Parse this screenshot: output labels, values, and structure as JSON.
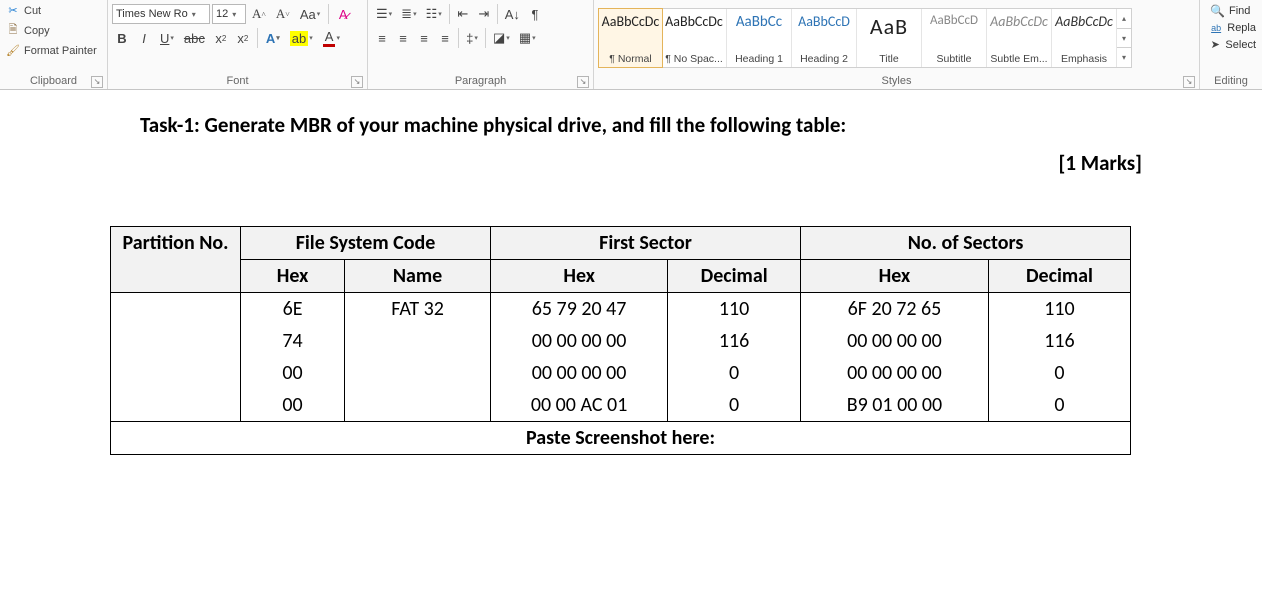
{
  "clipboard": {
    "cut": "Cut",
    "copy": "Copy",
    "format_painter": "Format Painter",
    "label": "Clipboard"
  },
  "font": {
    "name": "Times New Ro",
    "size": "12",
    "label": "Font"
  },
  "paragraph": {
    "label": "Paragraph"
  },
  "styles": {
    "label": "Styles",
    "items": [
      {
        "sample": "AaBbCcDc",
        "name": "¶ Normal"
      },
      {
        "sample": "AaBbCcDc",
        "name": "¶ No Spac..."
      },
      {
        "sample": "AaBbCc",
        "name": "Heading 1"
      },
      {
        "sample": "AaBbCcD",
        "name": "Heading 2"
      },
      {
        "sample": "AaB",
        "name": "Title"
      },
      {
        "sample": "AaBbCcD",
        "name": "Subtitle"
      },
      {
        "sample": "AaBbCcDc",
        "name": "Subtle Em..."
      },
      {
        "sample": "AaBbCcDc",
        "name": "Emphasis"
      }
    ]
  },
  "editing": {
    "label": "Editing",
    "find": "Find",
    "replace": "Repla",
    "select": "Select"
  },
  "doc": {
    "task_title": "Task-1: Generate MBR of your machine physical drive, and fill the following table:",
    "marks": "[1 Marks]",
    "headers": {
      "partition": "Partition No.",
      "fscode": "File System Code",
      "firstsector": "First Sector",
      "numsectors": "No. of Sectors",
      "hex": "Hex",
      "name": "Name",
      "decimal": "Decimal"
    },
    "rows": [
      {
        "fs_hex": "6E",
        "fs_name": "FAT 32",
        "first_hex": "65 79 20 47",
        "first_dec": "110",
        "num_hex": "6F 20 72 65",
        "num_dec": "110"
      },
      {
        "fs_hex": "74",
        "fs_name": "",
        "first_hex": "00 00 00 00",
        "first_dec": "116",
        "num_hex": "00 00 00 00",
        "num_dec": "116"
      },
      {
        "fs_hex": "00",
        "fs_name": "",
        "first_hex": "00 00 00 00",
        "first_dec": "0",
        "num_hex": "00 00 00 00",
        "num_dec": "0"
      },
      {
        "fs_hex": "00",
        "fs_name": "",
        "first_hex": "00 00 AC 01",
        "first_dec": "0",
        "num_hex": "B9 01 00 00",
        "num_dec": "0"
      }
    ],
    "paste_prompt": "Paste Screenshot here:"
  }
}
